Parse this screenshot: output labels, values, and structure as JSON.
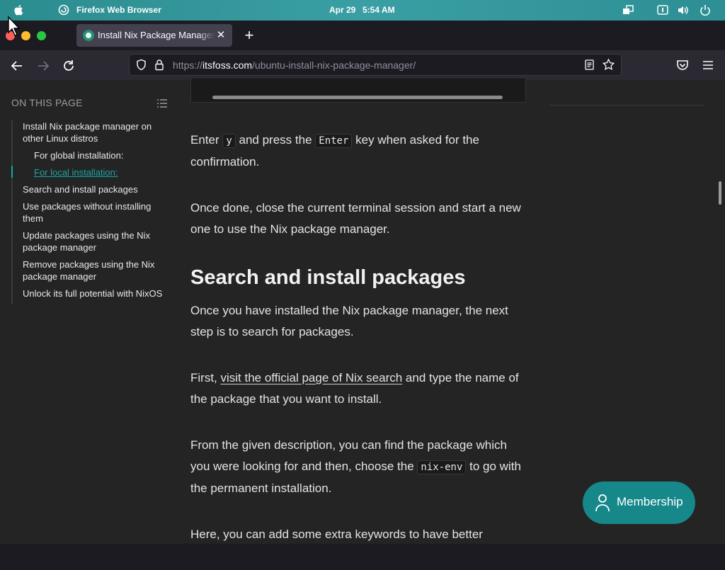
{
  "os_bar": {
    "app_name": "Firefox Web Browser",
    "date": "Apr 29",
    "time": "5:54 AM",
    "icons": [
      "apple-icon",
      "firefox-logo-icon",
      "window-switcher-icon",
      "accessibility-icon",
      "volume-icon",
      "power-icon"
    ]
  },
  "browser": {
    "tab": {
      "title": "Install Nix Package Manager",
      "close_glyph": "✕"
    },
    "new_tab_glyph": "+",
    "url": {
      "scheme": "https://",
      "host": "itsfoss.com",
      "path": "/ubuntu-install-nix-package-manager/"
    },
    "colors": {
      "tab_bg": "#42414d",
      "toolbar_bg": "#2b2a33",
      "frame_bg": "#1c1b22"
    }
  },
  "toc": {
    "heading": "ON THIS PAGE",
    "items": [
      {
        "label": "Install Nix package manager on other Linux distros"
      },
      {
        "label": "For global installation:"
      },
      {
        "label": "For local installation:"
      },
      {
        "label": "Search and install packages"
      },
      {
        "label": "Use packages without installing them"
      },
      {
        "label": "Update packages using the Nix package manager"
      },
      {
        "label": "Remove packages using the Nix package manager"
      },
      {
        "label": "Unlock its full potential with NixOS"
      }
    ]
  },
  "article": {
    "p1": {
      "t1": "Enter ",
      "code1": "y",
      "t2": " and press the ",
      "code2": "Enter",
      "t3": " key when asked for the confirmation."
    },
    "p2": "Once done, close the current terminal session and start a new one to use the Nix package manager.",
    "h2": "Search and install packages",
    "p3": "Once you have installed the Nix package manager, the next step is to search for packages.",
    "p4": {
      "t1": "First, ",
      "link": "visit the official page of Nix search",
      "t2": " and type the name of the package that you want to install."
    },
    "p5": {
      "t1": "From the given description, you can find the package which you were looking for and then, choose the ",
      "code": "nix-env",
      "t2": " to go with the permanent installation."
    },
    "p6": "Here, you can add some extra keywords to have better"
  },
  "membership": {
    "label": "Membership",
    "color": "#17888a"
  },
  "accent": "#1ba6a6"
}
